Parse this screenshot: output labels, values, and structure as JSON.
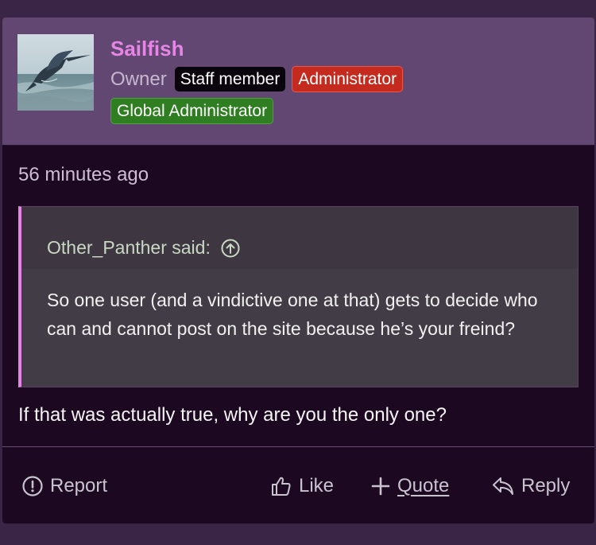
{
  "post": {
    "username": "Sailfish",
    "user_title": "Owner",
    "badges": {
      "staff": "Staff member",
      "admin": "Administrator",
      "global": "Global Administrator"
    },
    "timestamp": "56 minutes ago",
    "quote": {
      "author_line": "Other_Panther said:",
      "text": "So one user (and a vindictive one at that) gets to decide who can and cannot post on the site because he’s your freind?"
    },
    "body": "If that was actually true, why are you the only one?"
  },
  "actions": {
    "report": "Report",
    "like": "Like",
    "quote": "Quote",
    "reply": "Reply"
  },
  "colors": {
    "username": "#e586e4",
    "header_bg": "#614772",
    "post_bg": "#1d0822",
    "admin_badge": "#c42a1e",
    "global_badge": "#2f7e22"
  }
}
